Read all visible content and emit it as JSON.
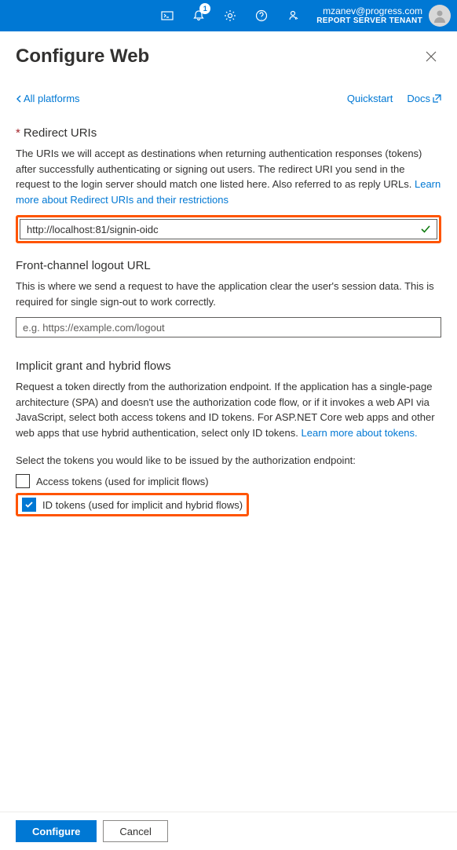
{
  "header": {
    "user_email": "mzanev@progress.com",
    "user_tenant": "REPORT SERVER TENANT",
    "notification_count": "1"
  },
  "page_title": "Configure Web",
  "nav": {
    "back_label": "All platforms",
    "quickstart_label": "Quickstart",
    "docs_label": "Docs"
  },
  "redirect_uris": {
    "heading": "Redirect URIs",
    "description_part1": "The URIs we will accept as destinations when returning authentication responses (tokens) after successfully authenticating or signing out users. The redirect URI you send in the request to the login server should match one listed here. Also referred to as reply URLs. ",
    "learn_link": "Learn more about Redirect URIs and their restrictions",
    "input_value": "http://localhost:81/signin-oidc"
  },
  "logout_url": {
    "heading": "Front-channel logout URL",
    "description": "This is where we send a request to have the application clear the user's session data. This is required for single sign-out to work correctly.",
    "placeholder": "e.g. https://example.com/logout",
    "value": ""
  },
  "implicit_grant": {
    "heading": "Implicit grant and hybrid flows",
    "description_part1": "Request a token directly from the authorization endpoint. If the application has a single-page architecture (SPA) and doesn't use the authorization code flow, or if it invokes a web API via JavaScript, select both access tokens and ID tokens. For ASP.NET Core web apps and other web apps that use hybrid authentication, select only ID tokens. ",
    "learn_link": "Learn more about tokens.",
    "prompt": "Select the tokens you would like to be issued by the authorization endpoint:",
    "access_tokens_label": "Access tokens (used for implicit flows)",
    "id_tokens_label": "ID tokens (used for implicit and hybrid flows)"
  },
  "footer": {
    "configure_label": "Configure",
    "cancel_label": "Cancel"
  }
}
